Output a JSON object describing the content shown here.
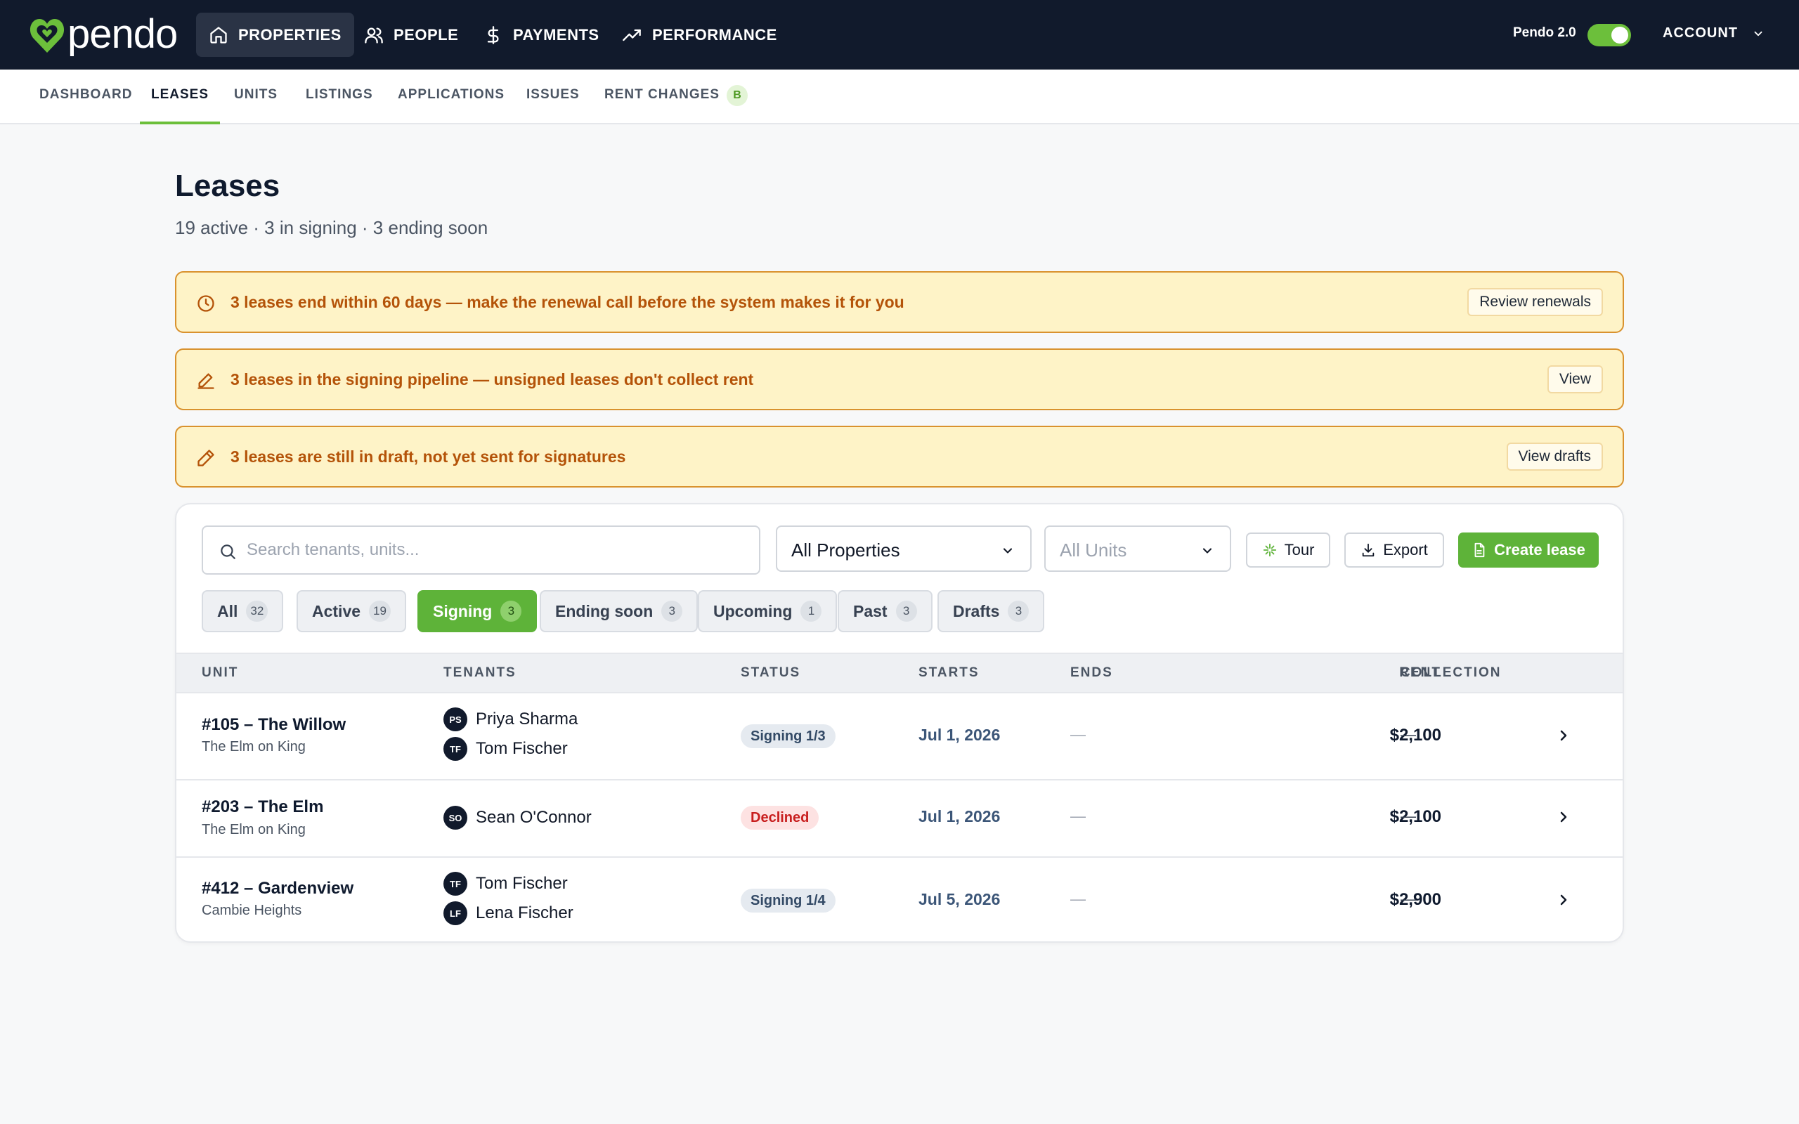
{
  "topnav": {
    "logo": "pendo",
    "items": [
      {
        "label": "PROPERTIES",
        "icon": "home-icon"
      },
      {
        "label": "PEOPLE",
        "icon": "people-icon"
      },
      {
        "label": "PAYMENTS",
        "icon": "dollar-icon"
      },
      {
        "label": "PERFORMANCE",
        "icon": "trend-up-icon"
      }
    ],
    "toggle_label": "Pendo 2.0",
    "toggle_on": true,
    "account_label": "ACCOUNT"
  },
  "subnav": {
    "tabs": [
      {
        "label": "DASHBOARD"
      },
      {
        "label": "LEASES"
      },
      {
        "label": "UNITS"
      },
      {
        "label": "LISTINGS"
      },
      {
        "label": "APPLICATIONS"
      },
      {
        "label": "ISSUES"
      },
      {
        "label": "RENT CHANGES",
        "badge": "B"
      }
    ],
    "active": "LEASES"
  },
  "page": {
    "title": "Leases",
    "subtitle": "19 active · 3 in signing · 3 ending soon"
  },
  "alerts": [
    {
      "icon": "clock-icon",
      "text": "3 leases end within 60 days — make the renewal call before the system makes it for you",
      "button": "Review renewals"
    },
    {
      "icon": "signature-icon",
      "text": "3 leases in the signing pipeline — unsigned leases don't collect rent",
      "button": "View"
    },
    {
      "icon": "pencil-icon",
      "text": "3 leases are still in draft, not yet sent for signatures",
      "button": "View drafts"
    }
  ],
  "toolbar": {
    "search_placeholder": "Search tenants, units...",
    "property_select": "All Properties",
    "unit_select": "All Units",
    "tour_label": "Tour",
    "export_label": "Export",
    "create_label": "Create lease"
  },
  "filters": [
    {
      "label": "All",
      "count": "32"
    },
    {
      "label": "Active",
      "count": "19"
    },
    {
      "label": "Signing",
      "count": "3"
    },
    {
      "label": "Ending soon",
      "count": "3"
    },
    {
      "label": "Upcoming",
      "count": "1"
    },
    {
      "label": "Past",
      "count": "3"
    },
    {
      "label": "Drafts",
      "count": "3"
    }
  ],
  "active_filter": "Signing",
  "table": {
    "columns": [
      "UNIT",
      "TENANTS",
      "STATUS",
      "STARTS",
      "ENDS",
      "RENT",
      "COLLECTION"
    ],
    "rows": [
      {
        "unit": "#105 – The Willow",
        "property": "The Elm on King",
        "tenants": [
          {
            "initials": "PS",
            "name": "Priya Sharma"
          },
          {
            "initials": "TF",
            "name": "Tom Fischer"
          }
        ],
        "status": "Signing 1/3",
        "status_kind": "signing",
        "starts": "Jul 1, 2026",
        "ends": "—",
        "rent": "$2,100",
        "collection": "—"
      },
      {
        "unit": "#203 – The Elm",
        "property": "The Elm on King",
        "tenants": [
          {
            "initials": "SO",
            "name": "Sean O'Connor"
          }
        ],
        "status": "Declined",
        "status_kind": "declined",
        "starts": "Jul 1, 2026",
        "ends": "—",
        "rent": "$2,100",
        "collection": "—"
      },
      {
        "unit": "#412 – Gardenview",
        "property": "Cambie Heights",
        "tenants": [
          {
            "initials": "TF",
            "name": "Tom Fischer"
          },
          {
            "initials": "LF",
            "name": "Lena Fischer"
          }
        ],
        "status": "Signing 1/4",
        "status_kind": "signing",
        "starts": "Jul 5, 2026",
        "ends": "—",
        "rent": "$2,900",
        "collection": "—"
      }
    ]
  },
  "colors": {
    "nav_bg": "#111a2c",
    "brand_green": "#5eb339",
    "alert_bg": "#fef3c7",
    "alert_border": "#d9922e",
    "alert_text": "#b45309",
    "declined": "#c81e1e"
  }
}
